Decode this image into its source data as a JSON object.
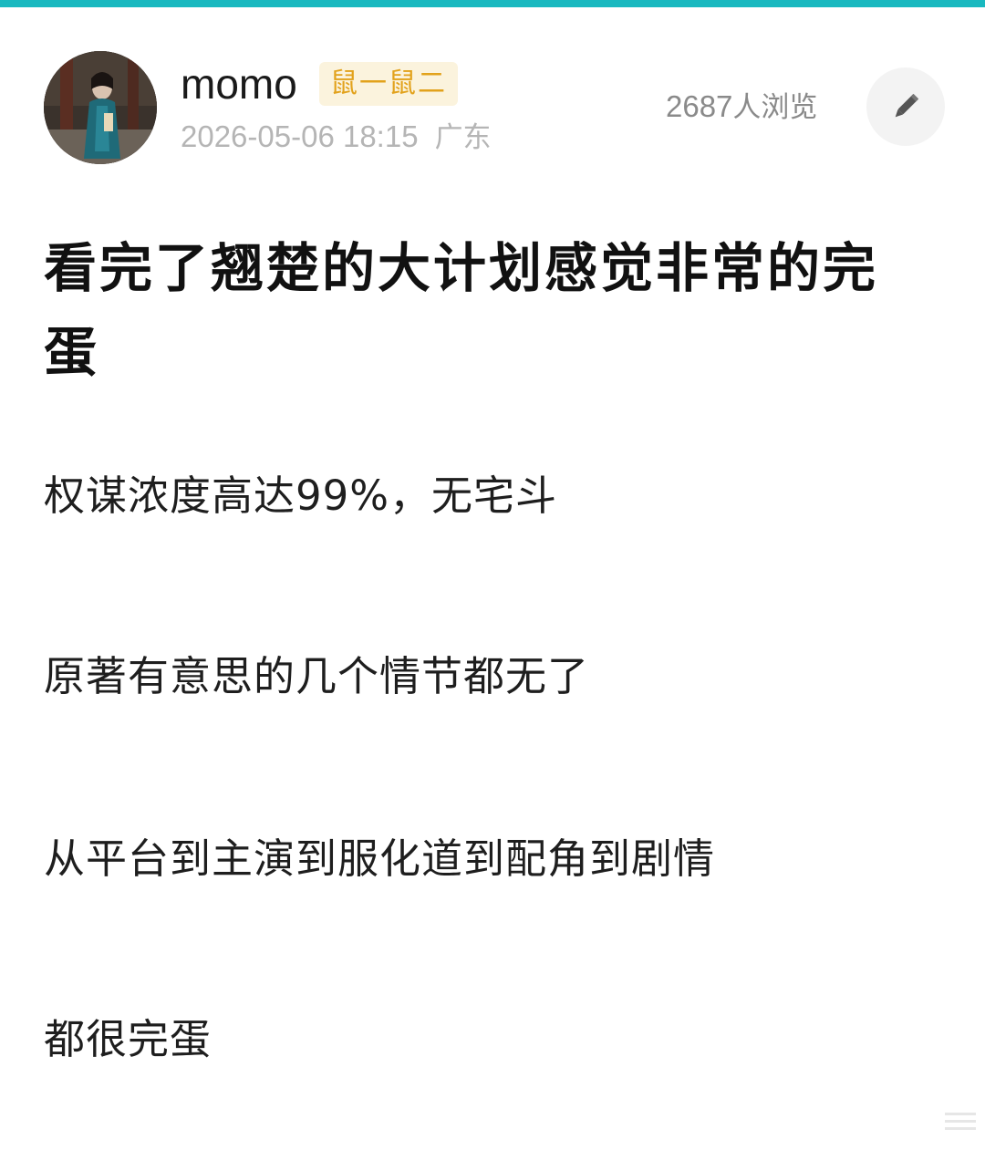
{
  "theme": {
    "accent": "#19b9c0",
    "badge_bg": "#fbf3dd",
    "badge_text": "#e2a21c",
    "meta_text": "#b5b5b5"
  },
  "post": {
    "author": {
      "name": "momo",
      "badge": "鼠一鼠二",
      "avatar_icon": "user-avatar-photo"
    },
    "timestamp": "2026-05-06 18:15",
    "region": "广东",
    "views_count": "2687",
    "views_suffix": "人浏览",
    "edit_icon": "pencil-icon",
    "title": "看完了翘楚的大计划感觉非常的完蛋",
    "paragraphs": [
      "权谋浓度高达99%，无宅斗",
      "原著有意思的几个情节都无了",
      "从平台到主演到服化道到配角到剧情",
      "都很完蛋"
    ]
  }
}
